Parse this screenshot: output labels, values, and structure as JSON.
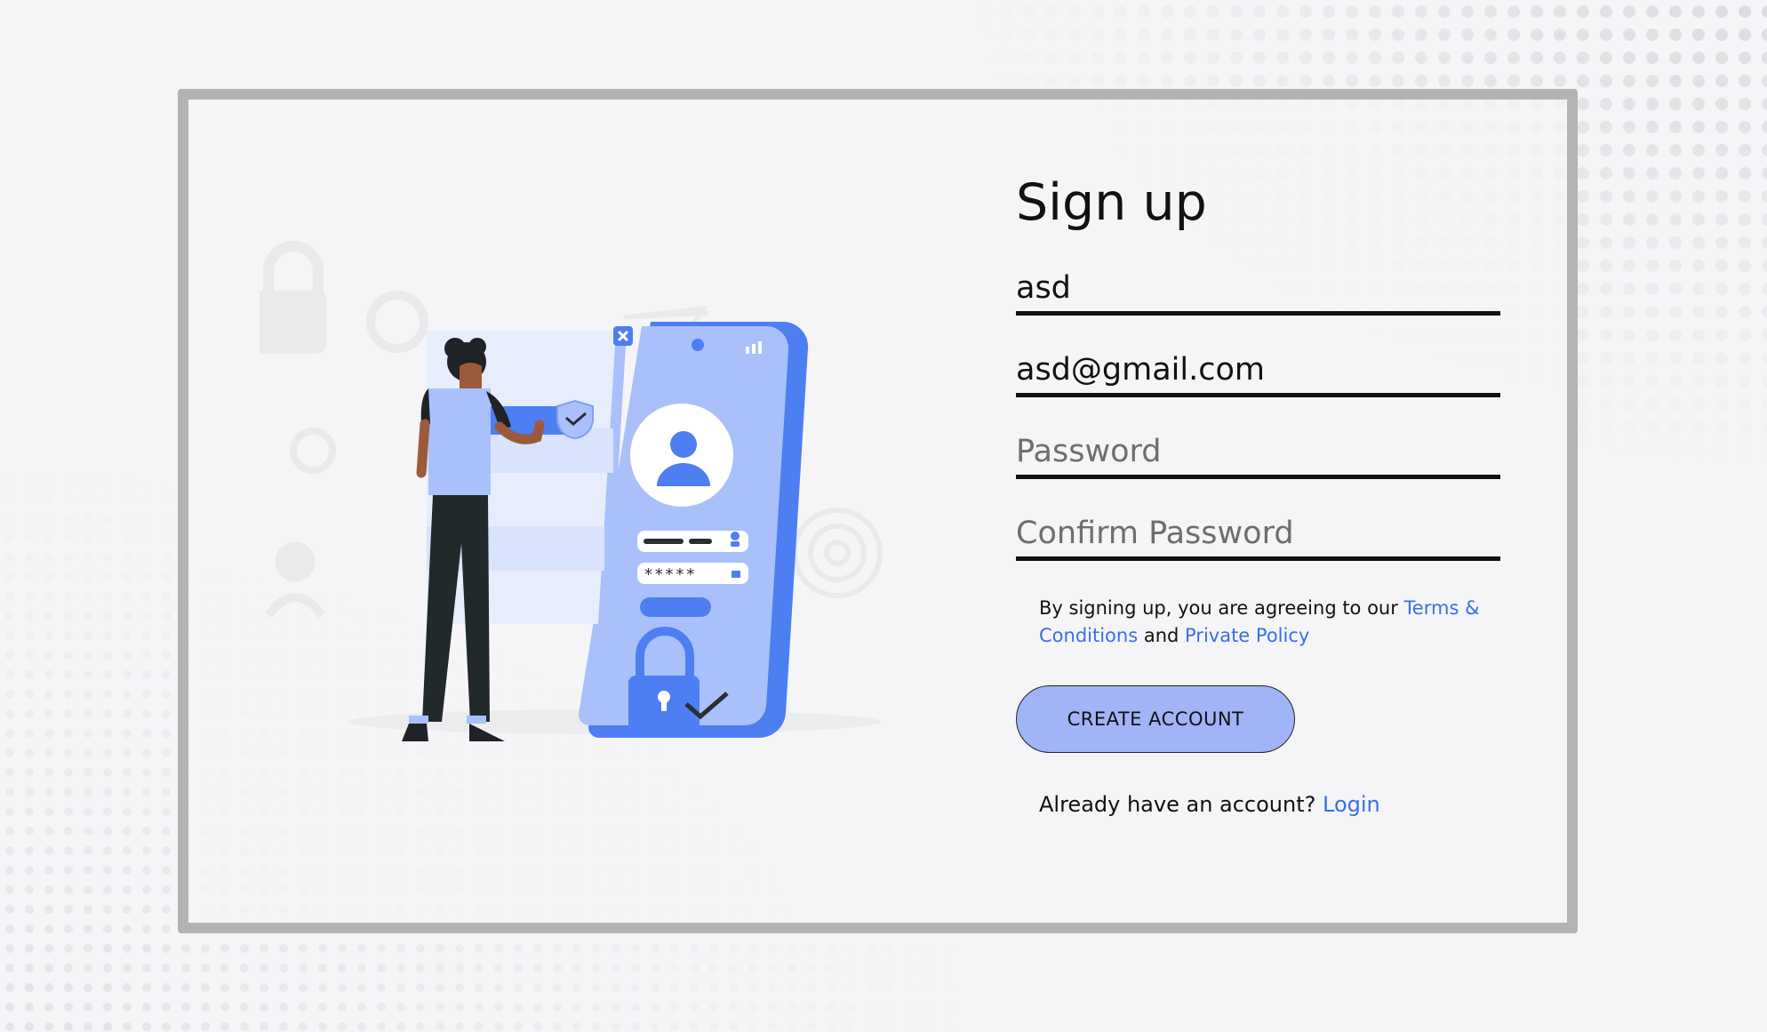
{
  "page": {
    "title": "Sign up"
  },
  "form": {
    "name_value": "asd",
    "email_value": "asd@gmail.com",
    "password_placeholder": "Password",
    "confirm_password_placeholder": "Confirm Password"
  },
  "terms": {
    "prefix": "By signing up, you are agreeing to our ",
    "terms_link": "Terms & Conditions",
    "middle": " and ",
    "privacy_link": "Private Policy"
  },
  "actions": {
    "create_account_label": "CREATE ACCOUNT"
  },
  "footer": {
    "prompt": "Already have an account? ",
    "login_link": "Login"
  },
  "colors": {
    "accent_blue": "#3a6ee8",
    "button_fill": "#a0b4f7",
    "illustration_blue": "#4d7ff2",
    "illustration_light_blue": "#a9c0fb",
    "frame_gray": "#b3b3b3"
  },
  "illustration": {
    "name": "person-unlocking-phone-illustration",
    "password_mask": "*****"
  }
}
